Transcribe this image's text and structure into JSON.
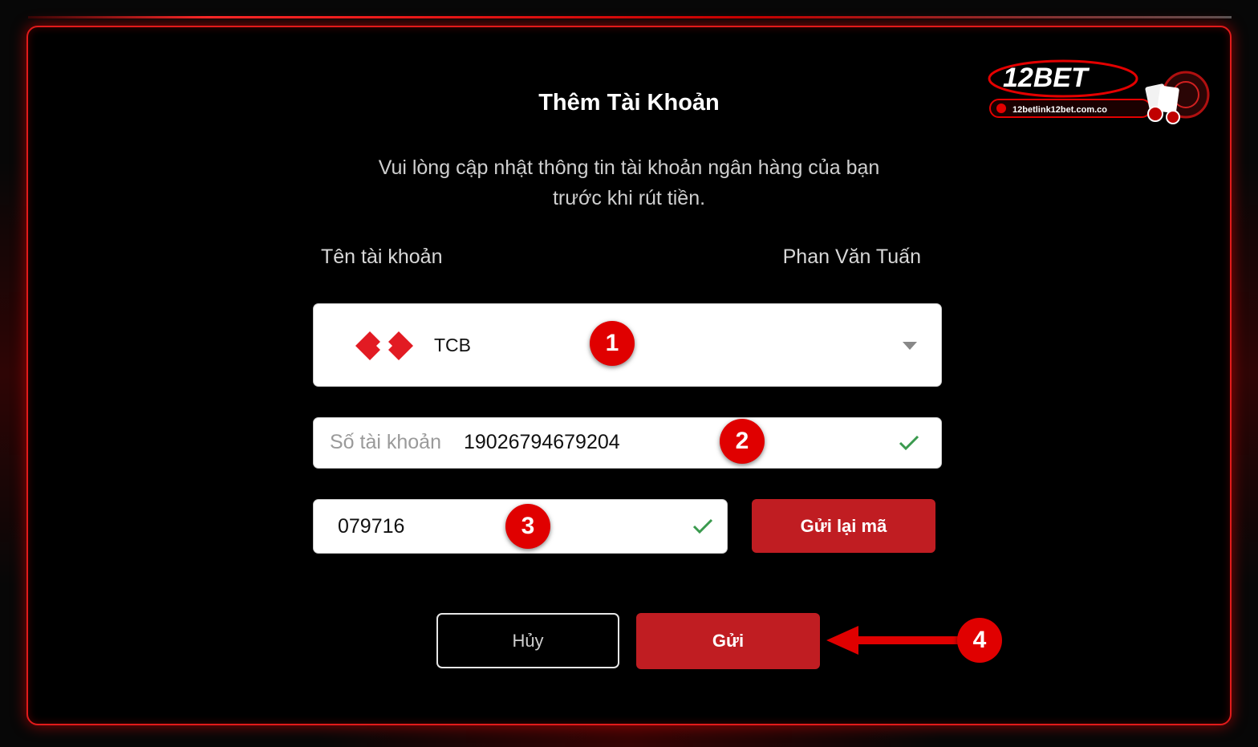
{
  "dialog": {
    "title": "Thêm Tài Khoản",
    "subtitle_line1": "Vui lòng cập nhật thông tin tài khoản ngân hàng của bạn",
    "subtitle_line2": "trước khi rút tiền."
  },
  "account_name": {
    "label": "Tên tài khoản",
    "value": "Phan Văn Tuấn"
  },
  "bank_select": {
    "selected": "TCB",
    "logo_icon": "techcombank-logo-icon",
    "caret_icon": "chevron-down-icon"
  },
  "account_number": {
    "placeholder": "Số tài khoản",
    "value": "19026794679204"
  },
  "otp": {
    "value": "079716",
    "resend_label": "Gửi lại mã"
  },
  "actions": {
    "cancel_label": "Hủy",
    "submit_label": "Gửi"
  },
  "brand": {
    "logo_text": "12BET",
    "logo_url_text": "12betlink12bet.com.co"
  },
  "annotations": {
    "step1": "1",
    "step2": "2",
    "step3": "3",
    "step4": "4"
  },
  "colors": {
    "accent": "#c01d22",
    "frame": "#e11b1b",
    "check": "#3a9a4e",
    "badge": "#e00000"
  }
}
